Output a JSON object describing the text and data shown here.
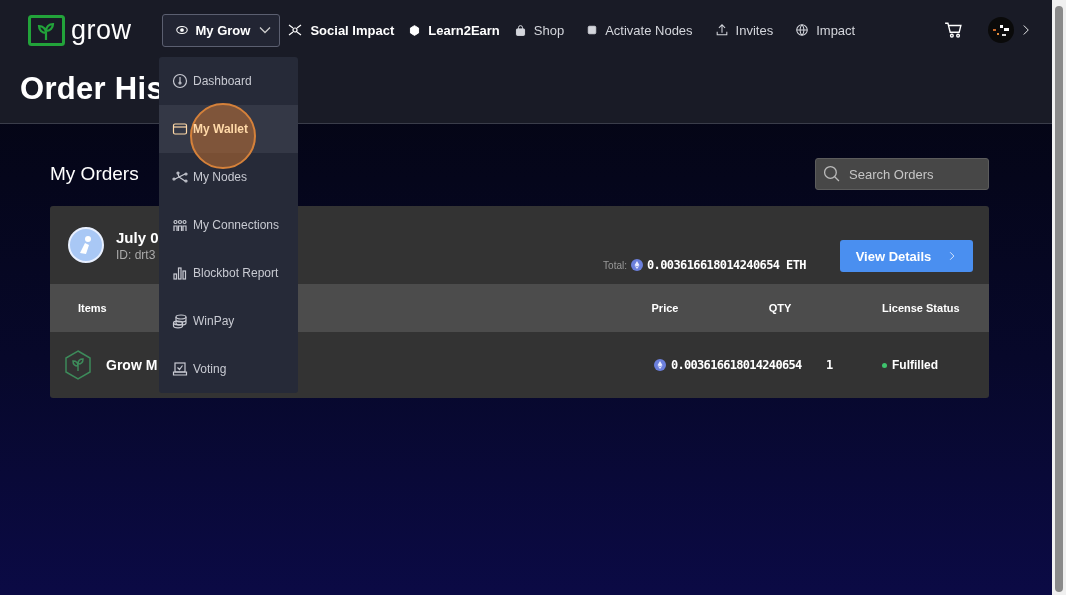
{
  "brand": "grow",
  "nav": [
    {
      "label": "My Grow",
      "kind": "dropdown",
      "selected": true
    },
    {
      "label": "Social Impact",
      "kind": "link",
      "selected": false
    },
    {
      "label": "Learn2Earn",
      "kind": "link",
      "selected": false
    },
    {
      "label": "Shop",
      "kind": "link",
      "selected": false
    },
    {
      "label": "Activate Nodes",
      "kind": "link",
      "selected": false
    },
    {
      "label": "Invites",
      "kind": "link",
      "selected": false
    },
    {
      "label": "Impact",
      "kind": "link",
      "selected": false
    }
  ],
  "page_title": "Order His",
  "menu": [
    {
      "label": "Dashboard",
      "selected": false
    },
    {
      "label": "My Wallet",
      "selected": true
    },
    {
      "label": "My Nodes",
      "selected": false
    },
    {
      "label": "My Connections",
      "selected": false
    },
    {
      "label": "Blockbot Report",
      "selected": false
    },
    {
      "label": "WinPay",
      "selected": false
    },
    {
      "label": "Voting",
      "selected": false
    }
  ],
  "section_title": "My Orders",
  "search": {
    "placeholder": "Search Orders"
  },
  "order": {
    "date": "July 0",
    "id": "ID: drt3",
    "total_label": "Total:",
    "total": "0.003616618014240654 ETH",
    "button": "View Details"
  },
  "table": {
    "columns": [
      "Items",
      "Price",
      "QTY",
      "License Status"
    ],
    "rows": [
      {
        "item": "Grow M",
        "price": "0.003616618014240654",
        "qty": "1",
        "status": "Fulfilled",
        "color": "#3ec46d"
      }
    ]
  }
}
